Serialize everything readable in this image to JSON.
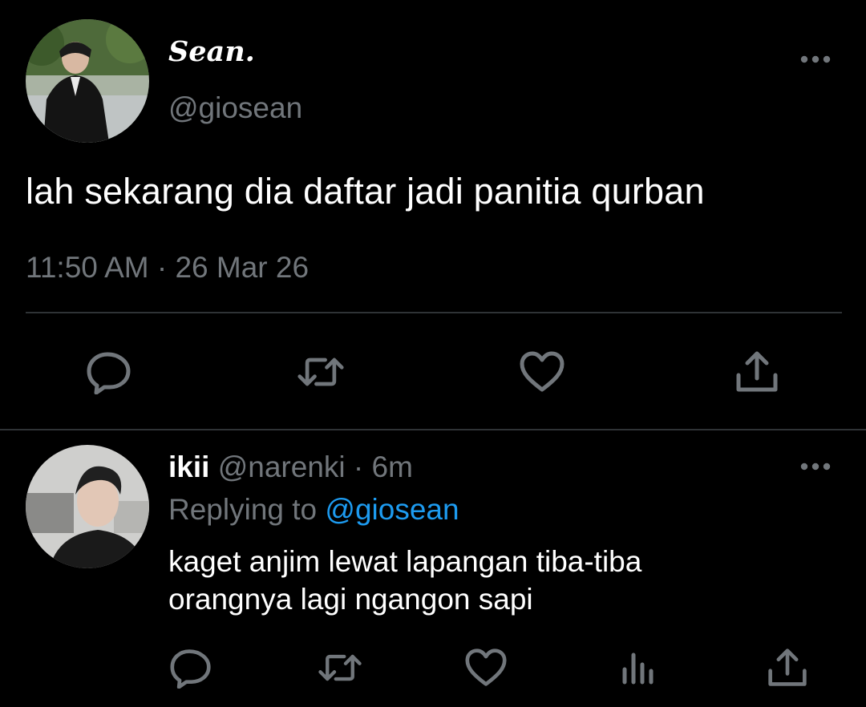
{
  "main_tweet": {
    "display_name": "Sean.",
    "handle": "@giosean",
    "text": "lah sekarang dia daftar jadi panitia qurban",
    "timestamp": "11:50 AM · 26 Mar 26",
    "avatar_icon": "user-avatar-photo",
    "more_icon": "more-dots-icon",
    "actions": [
      {
        "name": "reply",
        "icon": "reply-icon"
      },
      {
        "name": "retweet",
        "icon": "retweet-icon"
      },
      {
        "name": "like",
        "icon": "heart-icon"
      },
      {
        "name": "share",
        "icon": "share-icon"
      }
    ]
  },
  "reply_tweet": {
    "display_name": "ikii",
    "handle": "@narenki",
    "time_ago": "6m",
    "replying_prefix": "Replying to",
    "replying_to": "@giosean",
    "text_line_1": "kaget anjim lewat lapangan tiba-tiba",
    "text_line_2": "orangnya lagi ngangon sapi",
    "avatar_icon": "user-avatar-photo",
    "more_icon": "more-dots-icon",
    "actions": [
      {
        "name": "reply",
        "icon": "reply-icon"
      },
      {
        "name": "retweet",
        "icon": "retweet-icon"
      },
      {
        "name": "like",
        "icon": "heart-icon"
      },
      {
        "name": "analytics",
        "icon": "analytics-icon"
      },
      {
        "name": "share",
        "icon": "share-icon"
      }
    ]
  },
  "colors": {
    "background": "#000000",
    "primary_text": "#ffffff",
    "secondary_text": "#71767b",
    "divider": "#2f3336",
    "accent": "#1d9bf0"
  }
}
